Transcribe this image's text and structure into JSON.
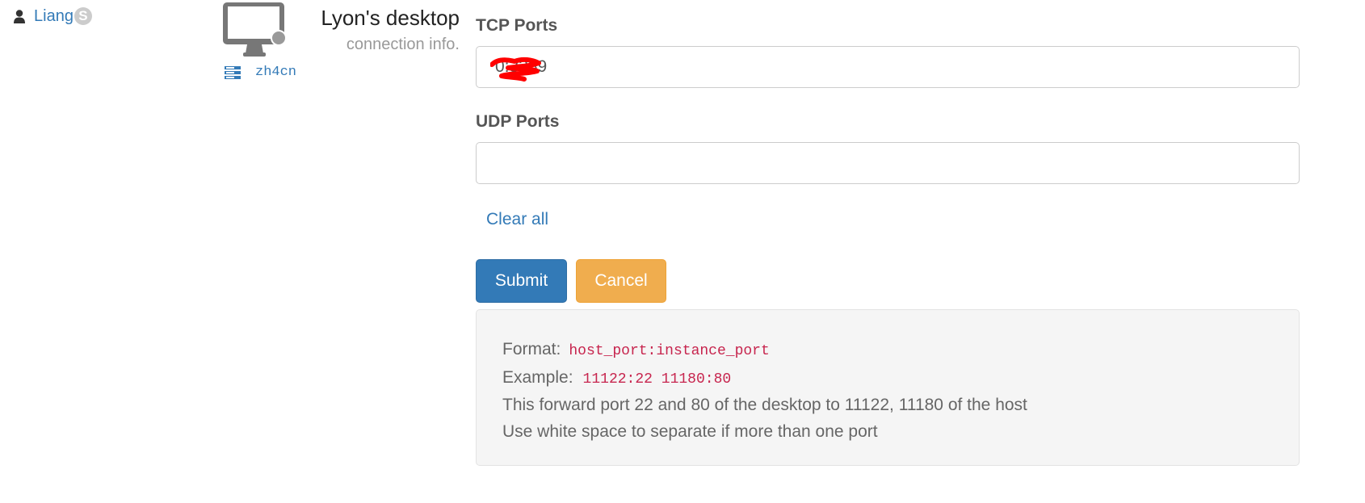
{
  "user": {
    "name": "Liang",
    "badge": "S",
    "icon": "user-icon"
  },
  "desktop": {
    "title": "Lyon's desktop",
    "subtitle": "connection info.",
    "icon": "monitor-icon",
    "server": {
      "icon": "server-icon",
      "name": "zh4cn"
    }
  },
  "form": {
    "tcp": {
      "label": "TCP Ports",
      "value": "   0:3389"
    },
    "udp": {
      "label": "UDP Ports",
      "value": ""
    },
    "clear_all": "Clear all",
    "submit": "Submit",
    "cancel": "Cancel"
  },
  "help": {
    "format_label": "Format:",
    "format_code": "host_port:instance_port",
    "example_label": "Example:",
    "example_code": "11122:22 11180:80",
    "line3": "This forward port 22 and 80 of the desktop to 11122, 11180 of the host",
    "line4": "Use white space to separate if more than one port"
  },
  "colors": {
    "primary": "#337ab7",
    "warning": "#f0ad4e",
    "code": "#c7254e",
    "help_bg": "#f5f5f5"
  }
}
